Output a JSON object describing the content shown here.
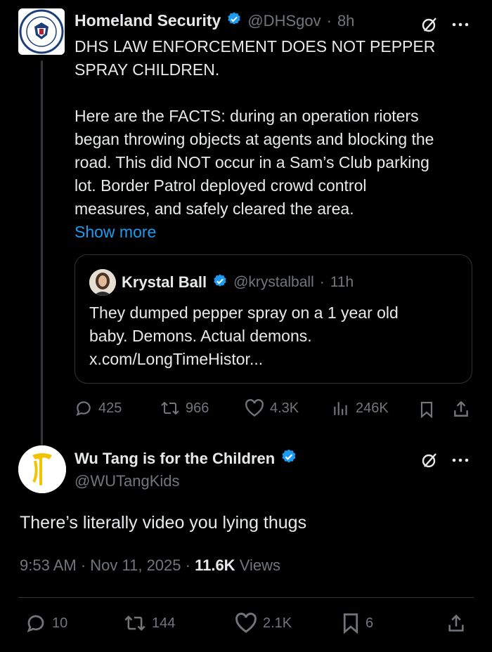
{
  "main_tweet": {
    "author_name": "Homeland Security",
    "handle": "@DHSgov",
    "time": "8h",
    "text_lines": [
      "DHS LAW ENFORCEMENT DOES NOT PEPPER",
      "SPRAY CHILDREN.",
      "",
      "Here are the FACTS: during an operation rioters",
      "began throwing objects at agents and blocking the",
      "road. This did NOT occur in a Sam’s Club parking",
      "lot. Border Patrol deployed crowd control",
      "measures, and safely cleared the area."
    ],
    "show_more": "Show more",
    "quoted": {
      "author_name": "Krystal Ball",
      "handle": "@krystalball",
      "time": "11h",
      "text_lines": [
        "They dumped pepper spray on a 1 year old",
        "baby. Demons. Actual demons.",
        "x.com/LongTimeHistor..."
      ]
    },
    "actions": {
      "replies": "425",
      "reposts": "966",
      "likes": "4.3K",
      "views": "246K"
    }
  },
  "reply": {
    "author_name": "Wu Tang is for the Children",
    "handle": "@WUTangKids",
    "text": "There’s literally video you lying thugs",
    "timestamp": "9:53 AM · Nov 11, 2025 ·",
    "views_count": "11.6K",
    "views_label": "Views",
    "actions": {
      "replies": "10",
      "reposts": "144",
      "likes": "2.1K",
      "bookmarks": "6"
    }
  },
  "colors": {
    "background": "#000000",
    "text": "#e7e9ea",
    "muted": "#71767b",
    "link": "#1d9bf0",
    "verified": "#1d9bf0",
    "border": "#2f3336"
  }
}
